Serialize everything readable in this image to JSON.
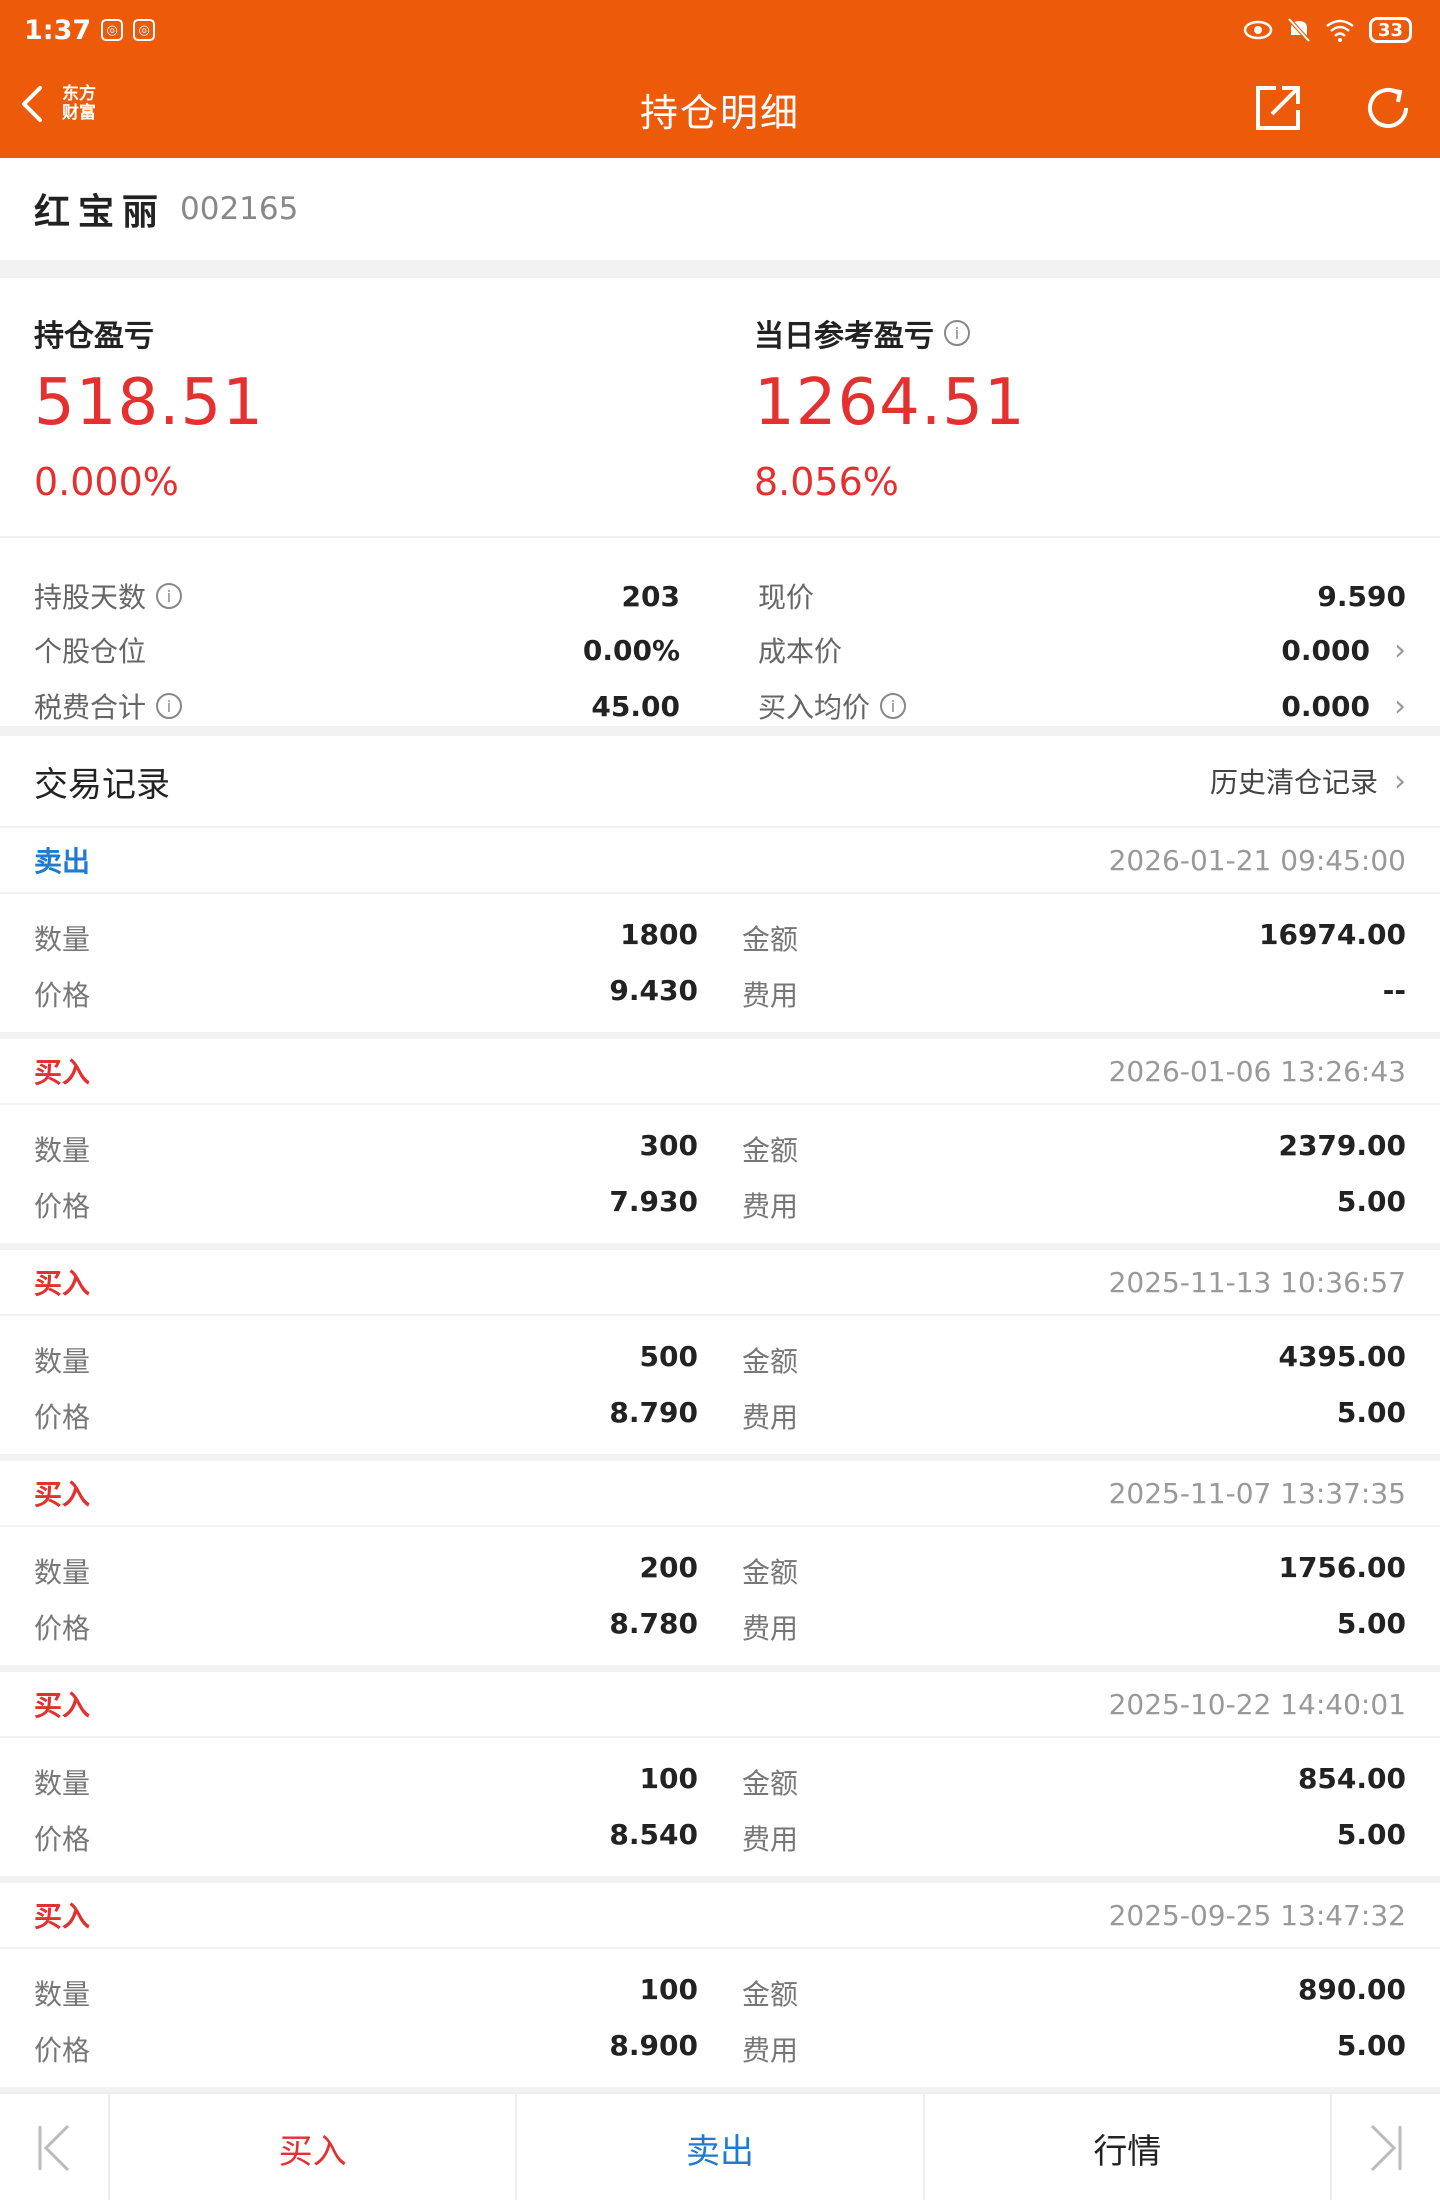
{
  "status_bar": {
    "time": "1:37",
    "battery": "33"
  },
  "nav": {
    "logo_line1": "东方",
    "logo_line2": "财富",
    "title": "持仓明细"
  },
  "stock": {
    "name": "红宝丽",
    "code": "002165"
  },
  "summary": {
    "position_pl_label": "持仓盈亏",
    "position_pl_value": "518.51",
    "position_pl_pct": "0.000%",
    "daily_pl_label": "当日参考盈亏",
    "daily_pl_value": "1264.51",
    "daily_pl_pct": "8.056%",
    "details_left": [
      {
        "label": "持股天数",
        "value": "203",
        "info": true
      },
      {
        "label": "个股仓位",
        "value": "0.00%",
        "info": false
      },
      {
        "label": "税费合计",
        "value": "45.00",
        "info": true
      }
    ],
    "details_right": [
      {
        "label": "现价",
        "value": "9.590",
        "info": false,
        "arrow": false
      },
      {
        "label": "成本价",
        "value": "0.000",
        "info": false,
        "arrow": true
      },
      {
        "label": "买入均价",
        "value": "0.000",
        "info": true,
        "arrow": true
      }
    ]
  },
  "records": {
    "title": "交易记录",
    "history_link": "历史清仓记录",
    "labels": {
      "qty": "数量",
      "price": "价格",
      "amount": "金额",
      "fee": "费用"
    },
    "items": [
      {
        "side": "卖出",
        "type": "sell",
        "date": "2026-01-21 09:45:00",
        "qty": "1800",
        "price": "9.430",
        "amount": "16974.00",
        "fee": "--"
      },
      {
        "side": "买入",
        "type": "buy",
        "date": "2026-01-06 13:26:43",
        "qty": "300",
        "price": "7.930",
        "amount": "2379.00",
        "fee": "5.00"
      },
      {
        "side": "买入",
        "type": "buy",
        "date": "2025-11-13 10:36:57",
        "qty": "500",
        "price": "8.790",
        "amount": "4395.00",
        "fee": "5.00"
      },
      {
        "side": "买入",
        "type": "buy",
        "date": "2025-11-07 13:37:35",
        "qty": "200",
        "price": "8.780",
        "amount": "1756.00",
        "fee": "5.00"
      },
      {
        "side": "买入",
        "type": "buy",
        "date": "2025-10-22 14:40:01",
        "qty": "100",
        "price": "8.540",
        "amount": "854.00",
        "fee": "5.00"
      },
      {
        "side": "买入",
        "type": "buy",
        "date": "2025-09-25 13:47:32",
        "qty": "100",
        "price": "8.900",
        "amount": "890.00",
        "fee": "5.00"
      }
    ]
  },
  "bottom_bar": {
    "buy": "买入",
    "sell": "卖出",
    "quote": "行情"
  },
  "colors": {
    "brand": "#ec5a0a",
    "up": "#e53030",
    "down": "#1f7bd1"
  }
}
